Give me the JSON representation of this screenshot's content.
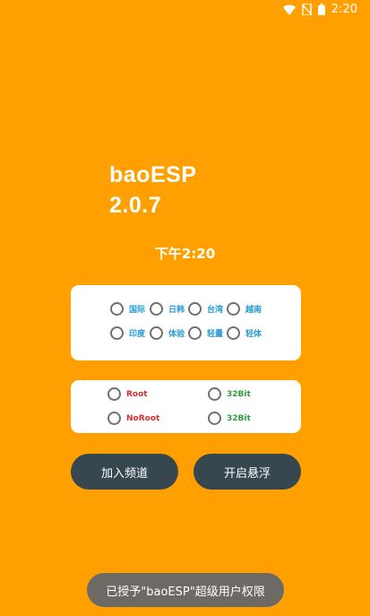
{
  "status_bar": {
    "time": "2:20"
  },
  "app": {
    "name": "baoESP",
    "version": "2.0.7"
  },
  "clock": "下午2:20",
  "modes": [
    {
      "label": "国际"
    },
    {
      "label": "日韩"
    },
    {
      "label": "台湾"
    },
    {
      "label": "越南"
    },
    {
      "label": "印度"
    },
    {
      "label": "体验"
    },
    {
      "label": "轻量"
    },
    {
      "label": "轻体"
    }
  ],
  "access": [
    {
      "label": "Root"
    },
    {
      "label": "NoRoot"
    }
  ],
  "arch": [
    {
      "label": "32Bit"
    },
    {
      "label": "32Bit"
    }
  ],
  "buttons": {
    "join": "加入频道",
    "float": "开启悬浮"
  },
  "toast": "已授予\"baoESP\"超级用户权限",
  "colors": {
    "background": "#FFA000",
    "button": "#37474F",
    "mode_text": "#2A9BD5",
    "root_text": "#D32F2F",
    "bit_text": "#2E9E3E"
  }
}
